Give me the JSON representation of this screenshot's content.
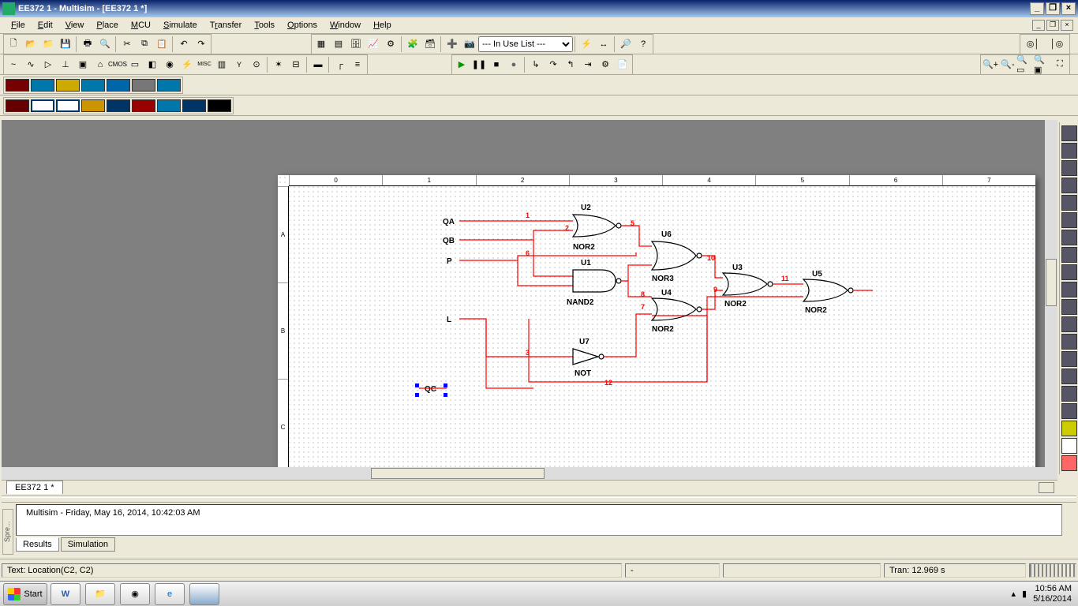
{
  "window": {
    "title": "EE372 1 - Multisim - [EE372 1 *]"
  },
  "menus": [
    "File",
    "Edit",
    "View",
    "Place",
    "MCU",
    "Simulate",
    "Transfer",
    "Tools",
    "Options",
    "Window",
    "Help"
  ],
  "use_list": {
    "selected": "--- In Use List ---"
  },
  "doctab": "EE372 1 *",
  "rulers": {
    "cols": [
      "0",
      "1",
      "2",
      "3",
      "4",
      "5",
      "6",
      "7"
    ],
    "rows": [
      "A",
      "B",
      "C"
    ]
  },
  "inputs": [
    "QA",
    "QB",
    "P",
    "L",
    "QC"
  ],
  "gates": [
    {
      "ref": "U2",
      "type": "NOR2"
    },
    {
      "ref": "U1",
      "type": "NAND2"
    },
    {
      "ref": "U6",
      "type": "NOR3"
    },
    {
      "ref": "U4",
      "type": "NOR2"
    },
    {
      "ref": "U3",
      "type": "NOR2"
    },
    {
      "ref": "U5",
      "type": "NOR2"
    },
    {
      "ref": "U7",
      "type": "NOT"
    }
  ],
  "nets": [
    "1",
    "2",
    "3",
    "5",
    "6",
    "7",
    "8",
    "9",
    "10",
    "11",
    "12"
  ],
  "output": {
    "line": "Multisim  -  Friday, May 16, 2014, 10:42:03 AM",
    "tabs": [
      "Results",
      "Simulation"
    ],
    "sidelabel": "Spre..."
  },
  "status": {
    "text": "Text: Location(C2, C2)",
    "mid": "-",
    "tran": "Tran: 12.969 s"
  },
  "taskbar": {
    "start": "Start",
    "time": "10:56 AM",
    "date": "5/16/2014"
  }
}
